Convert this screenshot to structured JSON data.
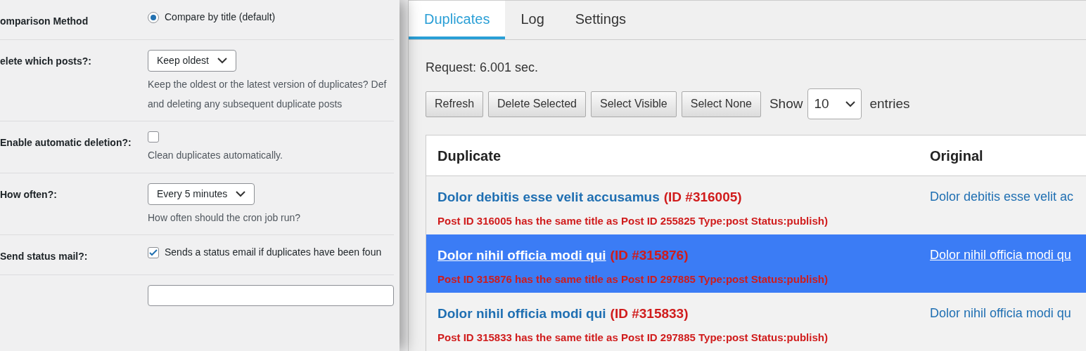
{
  "settings_panel": {
    "settings": [
      {
        "kind": "radio",
        "label": "omparison Method",
        "option": "Compare by title (default)",
        "selected": true
      },
      {
        "kind": "select",
        "label": "elete which posts?:",
        "value": "Keep oldest",
        "help": [
          "Keep the oldest or the latest version of duplicates? Def",
          "and deleting any subsequent duplicate posts"
        ]
      },
      {
        "kind": "checkbox",
        "label": "Enable automatic deletion?:",
        "checked": false,
        "help": [
          "Clean duplicates automatically."
        ]
      },
      {
        "kind": "select",
        "label": "How often?:",
        "value": "Every 5 minutes",
        "help": [
          "How often should the cron job run?"
        ]
      },
      {
        "kind": "checkbox",
        "label": "Send status mail?:",
        "checked": true,
        "text": "Sends a status email if duplicates have been foun"
      },
      {
        "kind": "field"
      }
    ]
  },
  "tabs": [
    {
      "label": "Duplicates",
      "selected": true
    },
    {
      "label": "Log",
      "selected": false
    },
    {
      "label": "Settings",
      "selected": false
    }
  ],
  "request_time": "Request: 6.001 sec.",
  "buttons": [
    "Refresh",
    "Delete Selected",
    "Select Visible",
    "Select None"
  ],
  "page_length": {
    "before": "Show",
    "value": "10",
    "after": "entries"
  },
  "table": {
    "columns": [
      "Duplicate",
      "Original"
    ],
    "rows": [
      {
        "selected": false,
        "title": "Dolor debitis esse velit accusamus",
        "id": "(ID #316005)",
        "note": "Post ID 316005 has the same title as Post ID 255825 Type:post Status:publish)",
        "original": "Dolor debitis esse velit ac"
      },
      {
        "selected": true,
        "title": "Dolor nihil officia modi qui",
        "id": "(ID #315876)",
        "note": "Post ID 315876 has the same title as Post ID 297885 Type:post Status:publish)",
        "original": "Dolor nihil officia modi qu"
      },
      {
        "selected": false,
        "title": "Dolor nihil officia modi qui",
        "id": "(ID #315833)",
        "note": "Post ID 315833 has the same title as Post ID 297885 Type:post Status:publish)",
        "original": "Dolor nihil officia modi qu"
      }
    ]
  }
}
